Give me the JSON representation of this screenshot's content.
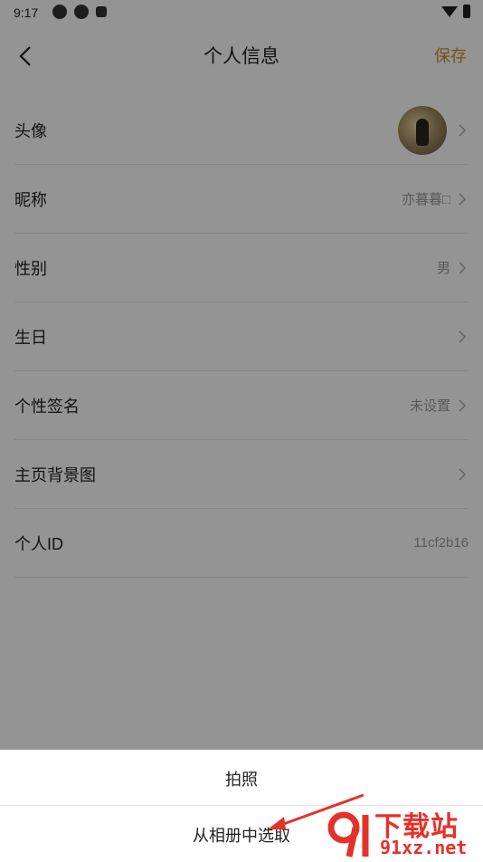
{
  "status_bar": {
    "time": "9:17"
  },
  "header": {
    "title": "个人信息",
    "save_label": "保存"
  },
  "rows": [
    {
      "label": "头像",
      "value": ""
    },
    {
      "label": "昵称",
      "value": "亦暮暮□"
    },
    {
      "label": "性别",
      "value": "男"
    },
    {
      "label": "生日",
      "value": ""
    },
    {
      "label": "个性签名",
      "value": "未设置"
    },
    {
      "label": "主页背景图",
      "value": ""
    },
    {
      "label": "个人ID",
      "value": "11cf2b16"
    }
  ],
  "sheet": {
    "options": [
      "拍照",
      "从相册中选取"
    ]
  },
  "watermark": {
    "brand": "下载站",
    "url": "91xz.net"
  },
  "colors": {
    "accent": "#d18b2a",
    "overlay": "rgba(0,0,0,0.42)",
    "watermark": "#e4322a"
  }
}
